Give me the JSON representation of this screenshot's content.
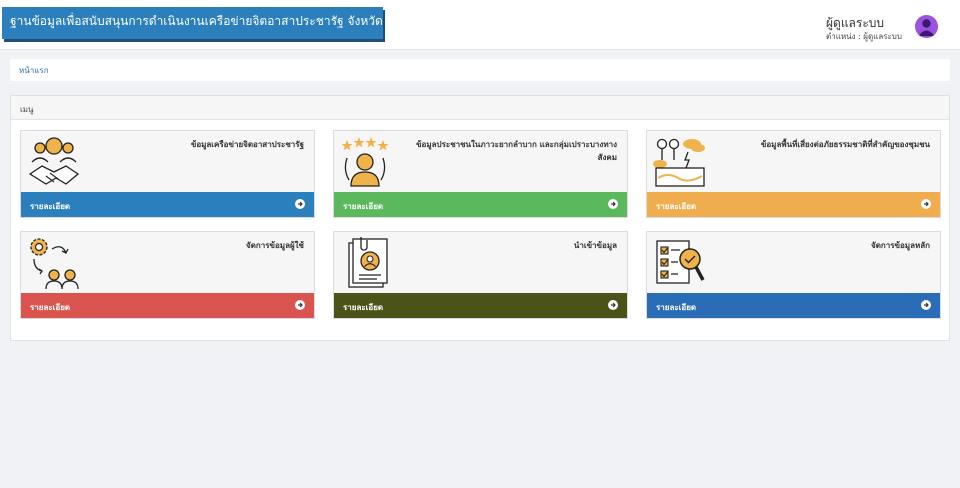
{
  "header": {
    "site_title": "ฐานข้อมูลเพื่อสนับสนุนการดำเนินงานเครือข่ายจิตอาสาประชารัฐ จังหวัดอุตรดิตถ์",
    "user_name": "ผู้ดูแลระบบ",
    "user_role": "ตำแหน่ง : ผู้ดูแลระบบ"
  },
  "breadcrumb": {
    "home": "หน้าแรก"
  },
  "menu": {
    "title": "เมนู",
    "cards": [
      {
        "title": "ข้อมูลเครือข่ายจิตอาสาประชารัฐ",
        "detail": "รายละเอียด",
        "color": "#2a7fbc",
        "icon": "handshake-icon"
      },
      {
        "title": "ข้อมูลประชาชนในภาวะยากลำบาก และกลุ่มเปราะบางทางสังคม",
        "detail": "รายละเอียด",
        "color": "#5cb85c",
        "icon": "person-rating-icon"
      },
      {
        "title": "ข้อมูลพื้นที่เสี่ยงต่อภัยธรรมชาติที่สำคัญของชุมชน",
        "detail": "รายละเอียด",
        "color": "#f0ad4e",
        "icon": "disaster-map-icon"
      },
      {
        "title": "จัดการข้อมูลผู้ใช้",
        "detail": "รายละเอียด",
        "color": "#d9534f",
        "icon": "user-management-icon"
      },
      {
        "title": "นำเข้าข้อมูล",
        "detail": "รายละเอียด",
        "color": "#4c5318",
        "icon": "import-document-icon"
      },
      {
        "title": "จัดการข้อมูลหลัก",
        "detail": "รายละเอียด",
        "color": "#2a6cb6",
        "icon": "checklist-search-icon"
      }
    ]
  }
}
